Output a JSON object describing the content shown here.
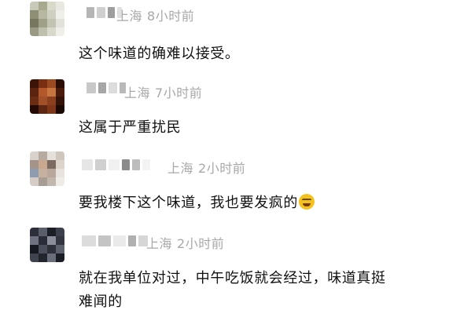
{
  "comments": [
    {
      "location": "上海",
      "time": "8小时前",
      "text": "这个味道的确难以接受。",
      "avatar_colors": [
        "#c9c9b9",
        "#a9a98f",
        "#dadacb",
        "#e8e8e0",
        "#8f8f76",
        "#b8b8a2",
        "#d0d0c1",
        "#f0f0ea",
        "#777760",
        "#a0a089",
        "#c3c3b2",
        "#e2e2da",
        "#9a9a84",
        "#bfbfad",
        "#d8d8cb",
        "#efefe8"
      ],
      "username_colors": [
        "#b5b5b5",
        "#cfcfcf",
        "#9e9e9e",
        "#e0e0e0"
      ]
    },
    {
      "location": "上海",
      "time": "7小时前",
      "text": "这属于严重扰民",
      "avatar_colors": [
        "#3d1508",
        "#7a2e12",
        "#9c4a22",
        "#2a0d05",
        "#5a2410",
        "#b3582a",
        "#c7763f",
        "#4a1a0a",
        "#6b2c14",
        "#a1512a",
        "#8c3f1c",
        "#331208",
        "#240a04",
        "#5e2611",
        "#7f3518",
        "#1c0803"
      ],
      "username_colors": [
        "#c8c8c8",
        "#a6a6a6",
        "#dcdcdc",
        "#b9b9b9"
      ]
    },
    {
      "location": "上海",
      "time": "2小时前",
      "text": "要我楼下这个味道，我也要发疯的",
      "avatar_colors": [
        "#d9d2cc",
        "#b7aaa0",
        "#e6e0da",
        "#cfc6bd",
        "#a39388",
        "#c9a890",
        "#7d6a60",
        "#ddd4cc",
        "#8e9bb0",
        "#c6b09f",
        "#b8a79a",
        "#e8e3df",
        "#d4ccc5",
        "#a89d94",
        "#c2b6ad",
        "#efebe7"
      ],
      "username_colors": [
        "#e6e6e6",
        "#cfcfcf",
        "#f0f0f0",
        "#8a8a8a",
        "#bdbdbd",
        "#f3f3f3"
      ]
    },
    {
      "location": "上海",
      "time": "2小时前",
      "text_lines": [
        "就在我单位对过，中午吃饭就会经过，味道真挺",
        "难闻的"
      ],
      "avatar_colors": [
        "#2c2f3a",
        "#5a5e6b",
        "#1d1f27",
        "#3c404c",
        "#6d7180",
        "#2a2d37",
        "#8a8e9b",
        "#33363f",
        "#16181f",
        "#4b4f5b",
        "#2e3139",
        "#5c606c",
        "#3f434e",
        "#23252d",
        "#6a6e7a",
        "#1b1d24"
      ],
      "username_colors": [
        "#dcdcdc",
        "#c4c4c4",
        "#eaeaea",
        "#b0b0b0",
        "#d6d6d6"
      ]
    }
  ]
}
